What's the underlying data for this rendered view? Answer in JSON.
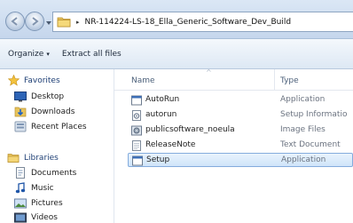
{
  "address_bar": {
    "path": "NR-114224-LS-18_Ella_Generic_Software_Dev_Build",
    "separator": "▸",
    "dropdown_glyph": "▾"
  },
  "toolbar": {
    "organize_label": "Organize",
    "organize_caret": "▾",
    "extract_label": "Extract all files"
  },
  "nav_pane": {
    "favorites": {
      "label": "Favorites",
      "icon": "star-icon",
      "items": [
        {
          "label": "Desktop",
          "icon": "desktop-icon"
        },
        {
          "label": "Downloads",
          "icon": "downloads-icon"
        },
        {
          "label": "Recent Places",
          "icon": "recent-places-icon"
        }
      ]
    },
    "libraries": {
      "label": "Libraries",
      "icon": "libraries-icon",
      "items": [
        {
          "label": "Documents",
          "icon": "documents-icon"
        },
        {
          "label": "Music",
          "icon": "music-icon"
        },
        {
          "label": "Pictures",
          "icon": "pictures-icon"
        },
        {
          "label": "Videos",
          "icon": "videos-icon"
        }
      ]
    }
  },
  "file_list": {
    "columns": {
      "name": "Name",
      "type": "Type",
      "sort_indicator": "^"
    },
    "rows": [
      {
        "name": "AutoRun",
        "type": "Application",
        "icon": "application-icon",
        "selected": false
      },
      {
        "name": "autorun",
        "type": "Setup Informatio",
        "icon": "setup-info-icon",
        "selected": false
      },
      {
        "name": "publicsoftware_noeula",
        "type": "Image Files",
        "icon": "image-file-icon",
        "selected": false
      },
      {
        "name": "ReleaseNote",
        "type": "Text Document",
        "icon": "text-document-icon",
        "selected": false
      },
      {
        "name": "Setup",
        "type": "Application",
        "icon": "application-icon",
        "selected": true
      }
    ]
  },
  "colors": {
    "selection_border": "#84acdd",
    "nav_header_text": "#1e3f75",
    "type_text": "#6b7380"
  }
}
